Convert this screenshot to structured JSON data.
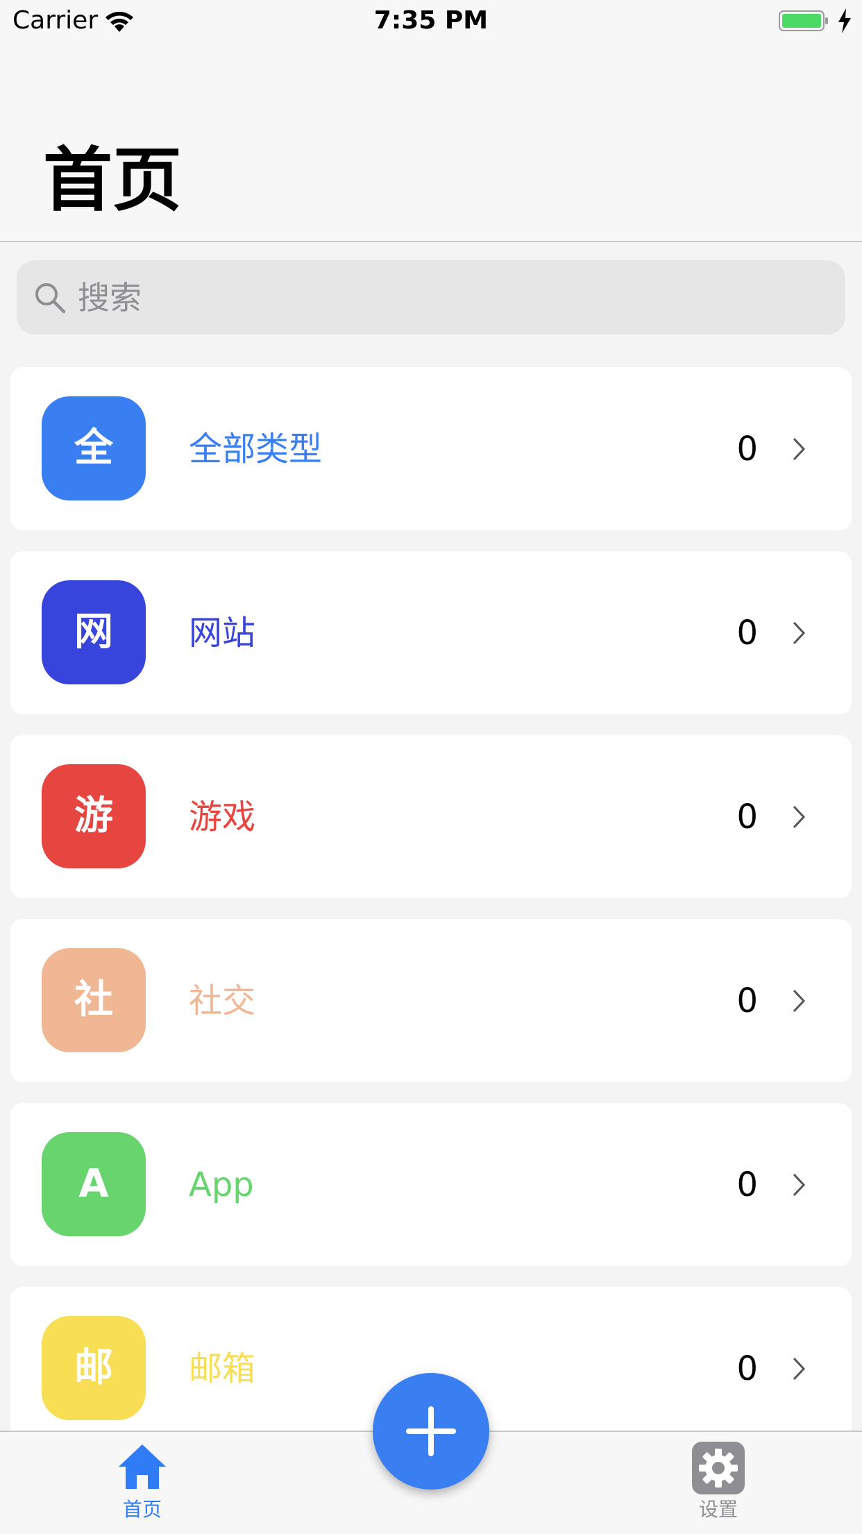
{
  "status_bar": {
    "carrier": "Carrier",
    "time": "7:35 PM",
    "wifi_icon": "wifi-icon",
    "battery_icon": "battery-icon",
    "charging_icon": "bolt-icon"
  },
  "header": {
    "title": "首页"
  },
  "search": {
    "placeholder": "搜索",
    "icon": "search-icon"
  },
  "categories": [
    {
      "badge": "全",
      "label": "全部类型",
      "count": "0",
      "color": "#3a7ff2"
    },
    {
      "badge": "网",
      "label": "网站",
      "count": "0",
      "color": "#3845dd"
    },
    {
      "badge": "游",
      "label": "游戏",
      "count": "0",
      "color": "#e74640"
    },
    {
      "badge": "社",
      "label": "社交",
      "count": "0",
      "color": "#f0b795"
    },
    {
      "badge": "A",
      "label": "App",
      "count": "0",
      "color": "#67d46e"
    },
    {
      "badge": "邮",
      "label": "邮箱",
      "count": "0",
      "color": "#f8de55"
    }
  ],
  "tab_bar": {
    "home_label": "首页",
    "settings_label": "设置",
    "home_icon": "home-icon",
    "settings_icon": "gear-icon",
    "active_color": "#2f7cf6",
    "inactive_color": "#8e8e93"
  },
  "fab": {
    "icon": "plus-icon",
    "color": "#3a7ff2"
  }
}
